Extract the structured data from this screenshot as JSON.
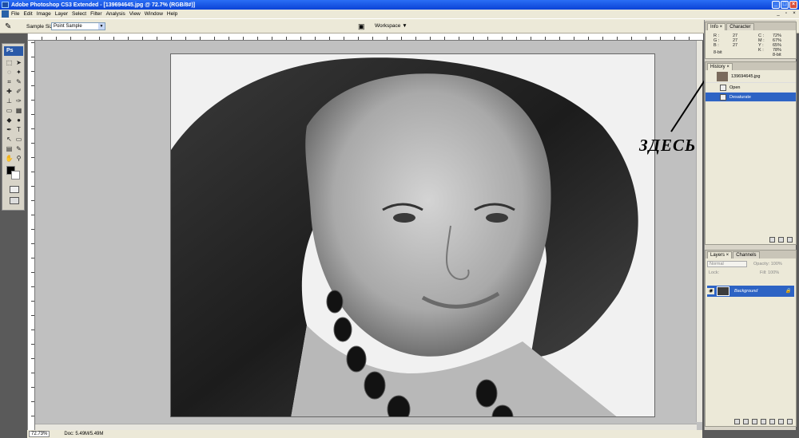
{
  "window": {
    "title": "Adobe Photoshop CS3 Extended - [139694645.jpg @ 72.7% (RGB/8#)]"
  },
  "menu": [
    "File",
    "Edit",
    "Image",
    "Layer",
    "Select",
    "Filter",
    "Analysis",
    "View",
    "Window",
    "Help"
  ],
  "options": {
    "sample_size_label": "Sample Size:",
    "sample_size_value": "Point Sample",
    "workspace_label": "Workspace ▼"
  },
  "toolbox": {
    "logo": "Ps"
  },
  "annotation": {
    "label": "ЗДЕСЬ"
  },
  "panels": {
    "info": {
      "tabs": [
        "Info ×",
        "Character"
      ],
      "r_label": "R :",
      "g_label": "G :",
      "b_label": "B :",
      "r": "27",
      "g": "27",
      "b": "27",
      "c_label": "C :",
      "m_label": "M :",
      "y_label": "Y :",
      "k_label": "K :",
      "c": "72%",
      "m": "67%",
      "y": "65%",
      "k": "78%",
      "bit1": "8-bit",
      "bit2": "8-bit"
    },
    "history": {
      "tabs": [
        "History ×"
      ],
      "snapshot": "139694645.jpg",
      "steps": [
        "Open",
        "Desaturate"
      ]
    },
    "layers": {
      "tabs": [
        "Layers ×",
        "Channels"
      ],
      "blend": "Normal",
      "opacity": "Opacity: 100%",
      "lock": "Lock:",
      "fill": "Fill: 100%",
      "layer_name": "Background"
    }
  },
  "status": {
    "zoom": "72.73%",
    "doc": "Doc: 5.49M/5.49M"
  },
  "colors": {
    "title_bar": "#0b43d6",
    "selected": "#2d63c4",
    "panel": "#ece9d8"
  }
}
